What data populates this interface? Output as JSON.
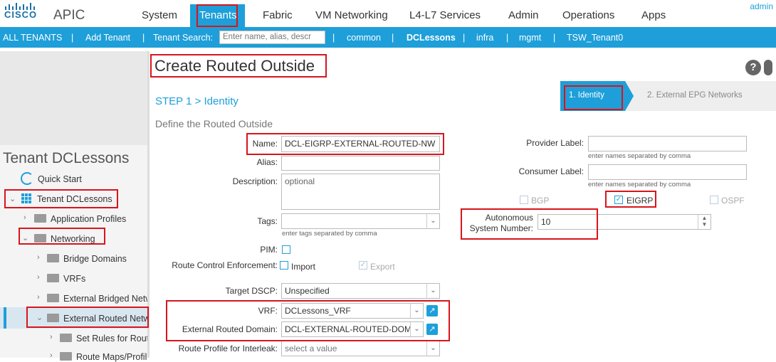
{
  "header": {
    "brand": "CISCO",
    "app": "APIC",
    "nav": [
      "System",
      "Tenants",
      "Fabric",
      "VM Networking",
      "L4-L7 Services",
      "Admin",
      "Operations",
      "Apps"
    ],
    "user": "admin"
  },
  "subnav": {
    "all_tenants": "ALL TENANTS",
    "add_tenant": "Add Tenant",
    "search_label": "Tenant Search:",
    "search_placeholder": "Enter name, alias, descr",
    "tenants": [
      "common",
      "DCLessons",
      "infra",
      "mgmt",
      "TSW_Tenant0"
    ],
    "sep": "|"
  },
  "sidebar": {
    "title": "Tenant DCLessons",
    "quick_start": "Quick Start",
    "tenant": "Tenant DCLessons",
    "app_profiles": "Application Profiles",
    "networking": "Networking",
    "bridge_domains": "Bridge Domains",
    "vrfs": "VRFs",
    "ext_bridged": "External Bridged Netw",
    "ext_routed": "External Routed Netw",
    "set_rules": "Set Rules for Rout",
    "route_maps": "Route Maps/Profil"
  },
  "wizard": {
    "title": "Create Routed Outside",
    "step_label": "STEP 1 > Identity",
    "step1": "1. Identity",
    "step2": "2. External EPG Networks",
    "section": "Define the Routed Outside",
    "help": "?"
  },
  "form": {
    "name_label": "Name:",
    "name_value": "DCL-EIGRP-EXTERNAL-ROUTED-NW",
    "alias_label": "Alias:",
    "desc_label": "Description:",
    "desc_placeholder": "optional",
    "tags_label": "Tags:",
    "tags_hint": "enter tags separated by comma",
    "pim_label": "PIM:",
    "rce_label": "Route Control Enforcement:",
    "import_label": "Import",
    "export_label": "Export",
    "dscp_label": "Target DSCP:",
    "dscp_value": "Unspecified",
    "vrf_label": "VRF:",
    "vrf_value": "DCLessons_VRF",
    "domain_label": "External Routed Domain:",
    "domain_value": "DCL-EXTERNAL-ROUTED-DOM",
    "interleak_label": "Route Profile for Interleak:",
    "interleak_value": "select a value",
    "provider_label": "Provider Label:",
    "provider_hint": "enter names separated by comma",
    "consumer_label": "Consumer Label:",
    "consumer_hint": "enter names separated by comma",
    "bgp": "BGP",
    "eigrp": "EIGRP",
    "ospf": "OSPF",
    "asn_label_1": "Autonomous",
    "asn_label_2": "System Number:",
    "asn_value": "10"
  },
  "colors": {
    "accent": "#1e9fd9",
    "highlight": "#d9141b"
  }
}
